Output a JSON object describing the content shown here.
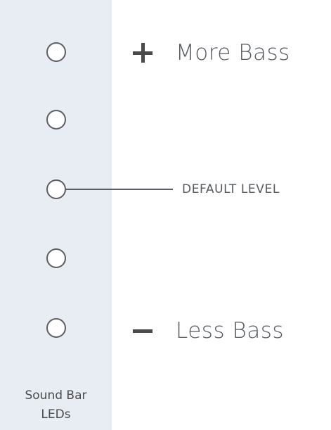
{
  "leds": {
    "count": 5,
    "caption_line1": "Sound Bar",
    "caption_line2": "LEDs"
  },
  "levels": {
    "more": "More Bass",
    "default": "DEFAULT LEVEL",
    "less": "Less Bass"
  },
  "icons": {
    "more": "plus-icon",
    "less": "minus-icon"
  },
  "colors": {
    "strip": "#e8edf3",
    "outline": "#5a5f66",
    "text": "#555a60"
  }
}
